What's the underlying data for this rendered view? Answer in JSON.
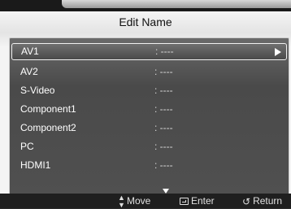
{
  "header": {
    "title": "Edit Name"
  },
  "list": {
    "items": [
      {
        "name": "AV1",
        "value": ": ----"
      },
      {
        "name": "AV2",
        "value": ": ----"
      },
      {
        "name": "S-Video",
        "value": ": ----"
      },
      {
        "name": "Component1",
        "value": ": ----"
      },
      {
        "name": "Component2",
        "value": ": ----"
      },
      {
        "name": "PC",
        "value": ": ----"
      },
      {
        "name": "HDMI1",
        "value": ": ----"
      }
    ],
    "more_indicator": "down-arrow"
  },
  "footer": {
    "move": {
      "icon": "updown-arrows-icon",
      "glyph": "▲\n▼",
      "label": "Move"
    },
    "enter": {
      "icon": "enter-key-icon",
      "label": "Enter"
    },
    "return": {
      "icon": "return-arrow-icon",
      "glyph": "↺",
      "label": "Return"
    }
  },
  "colors": {
    "panel_bg": "#f0f0f0",
    "list_bg": "#555555",
    "footer_bg": "#1f1f1f",
    "text": "#ffffff"
  }
}
